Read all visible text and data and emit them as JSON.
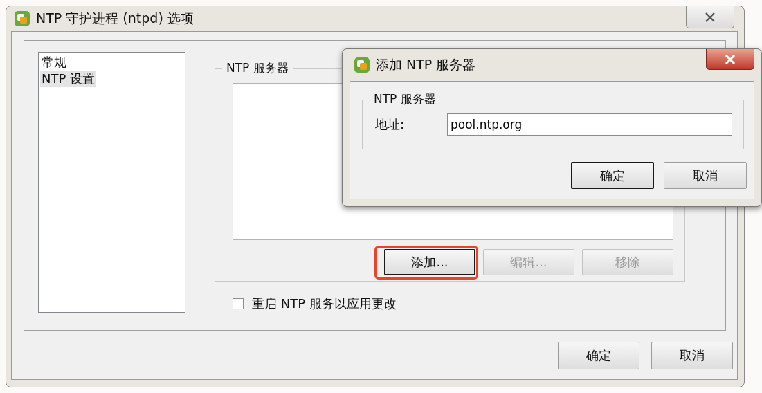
{
  "main_window": {
    "title": "NTP 守护进程 (ntpd) 选项",
    "sidebar": {
      "items": [
        {
          "label": "常规",
          "selected": false
        },
        {
          "label": "NTP 设置",
          "selected": true
        }
      ]
    },
    "ntp_group": {
      "title": "NTP 服务器",
      "buttons": [
        {
          "label": "添加...",
          "disabled": false,
          "focused": true,
          "highlighted": true
        },
        {
          "label": "编辑...",
          "disabled": true,
          "focused": false,
          "highlighted": false
        },
        {
          "label": "移除",
          "disabled": true,
          "focused": false,
          "highlighted": false
        }
      ]
    },
    "restart_checkbox": {
      "label": "重启 NTP 服务以应用更改",
      "checked": false
    },
    "buttons": [
      {
        "label": "确定"
      },
      {
        "label": "取消"
      }
    ]
  },
  "dialog": {
    "title": "添加 NTP 服务器",
    "group_title": "NTP 服务器",
    "field": {
      "label": "地址:",
      "value": "pool.ntp.org"
    },
    "buttons": [
      {
        "label": "确定",
        "focused": true
      },
      {
        "label": "取消",
        "focused": false
      }
    ]
  }
}
